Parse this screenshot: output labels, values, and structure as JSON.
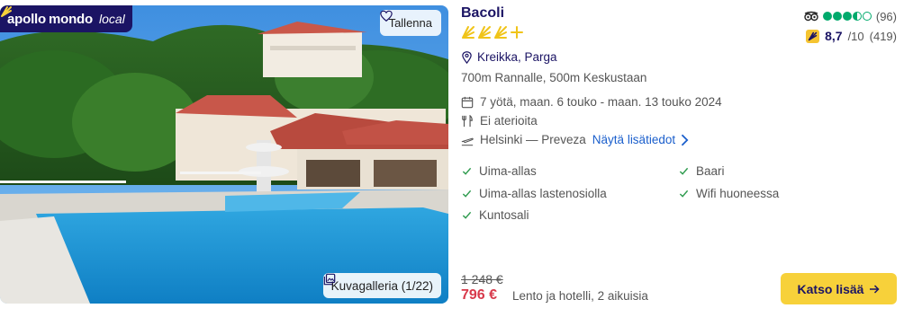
{
  "brand": {
    "apollo": "apollo",
    "mondo": "mondo",
    "local": "local"
  },
  "photo": {
    "save_label": "Tallenna",
    "gallery_label": "Kuvagalleria (1/22)"
  },
  "hotel": {
    "name": "Bacoli",
    "stars": 3,
    "half_star": true,
    "location": "Kreikka, Parga",
    "distances": "700m Rannalle, 500m Keskustaan"
  },
  "ratings": {
    "tripadvisor_score": 3.5,
    "tripadvisor_count": "(96)",
    "score": "8,7",
    "score_scale": "/10",
    "score_count": "(419)"
  },
  "trip": {
    "dates": "7 yötä, maan. 6 touko - maan. 13 touko 2024",
    "meals": "Ei aterioita",
    "flight": "Helsinki — Preveza",
    "details_link": "Näytä lisätiedot"
  },
  "amenities": {
    "left": [
      "Uima-allas",
      "Uima-allas lastenosiolla",
      "Kuntosali"
    ],
    "right": [
      "Baari",
      "Wifi huoneessa"
    ]
  },
  "pricing": {
    "old_price": "1 248 €",
    "price": "796 €",
    "description": "Lento ja hotelli, 2 aikuisia",
    "cta_label": "Katso lisää"
  },
  "colors": {
    "brand_navy": "#1b1464",
    "price_red": "#d8394b",
    "cta_yellow": "#f7d13a",
    "check_green": "#2e9b4e",
    "tripadvisor_green": "#00aa6c",
    "link_blue": "#1b5fcc"
  }
}
